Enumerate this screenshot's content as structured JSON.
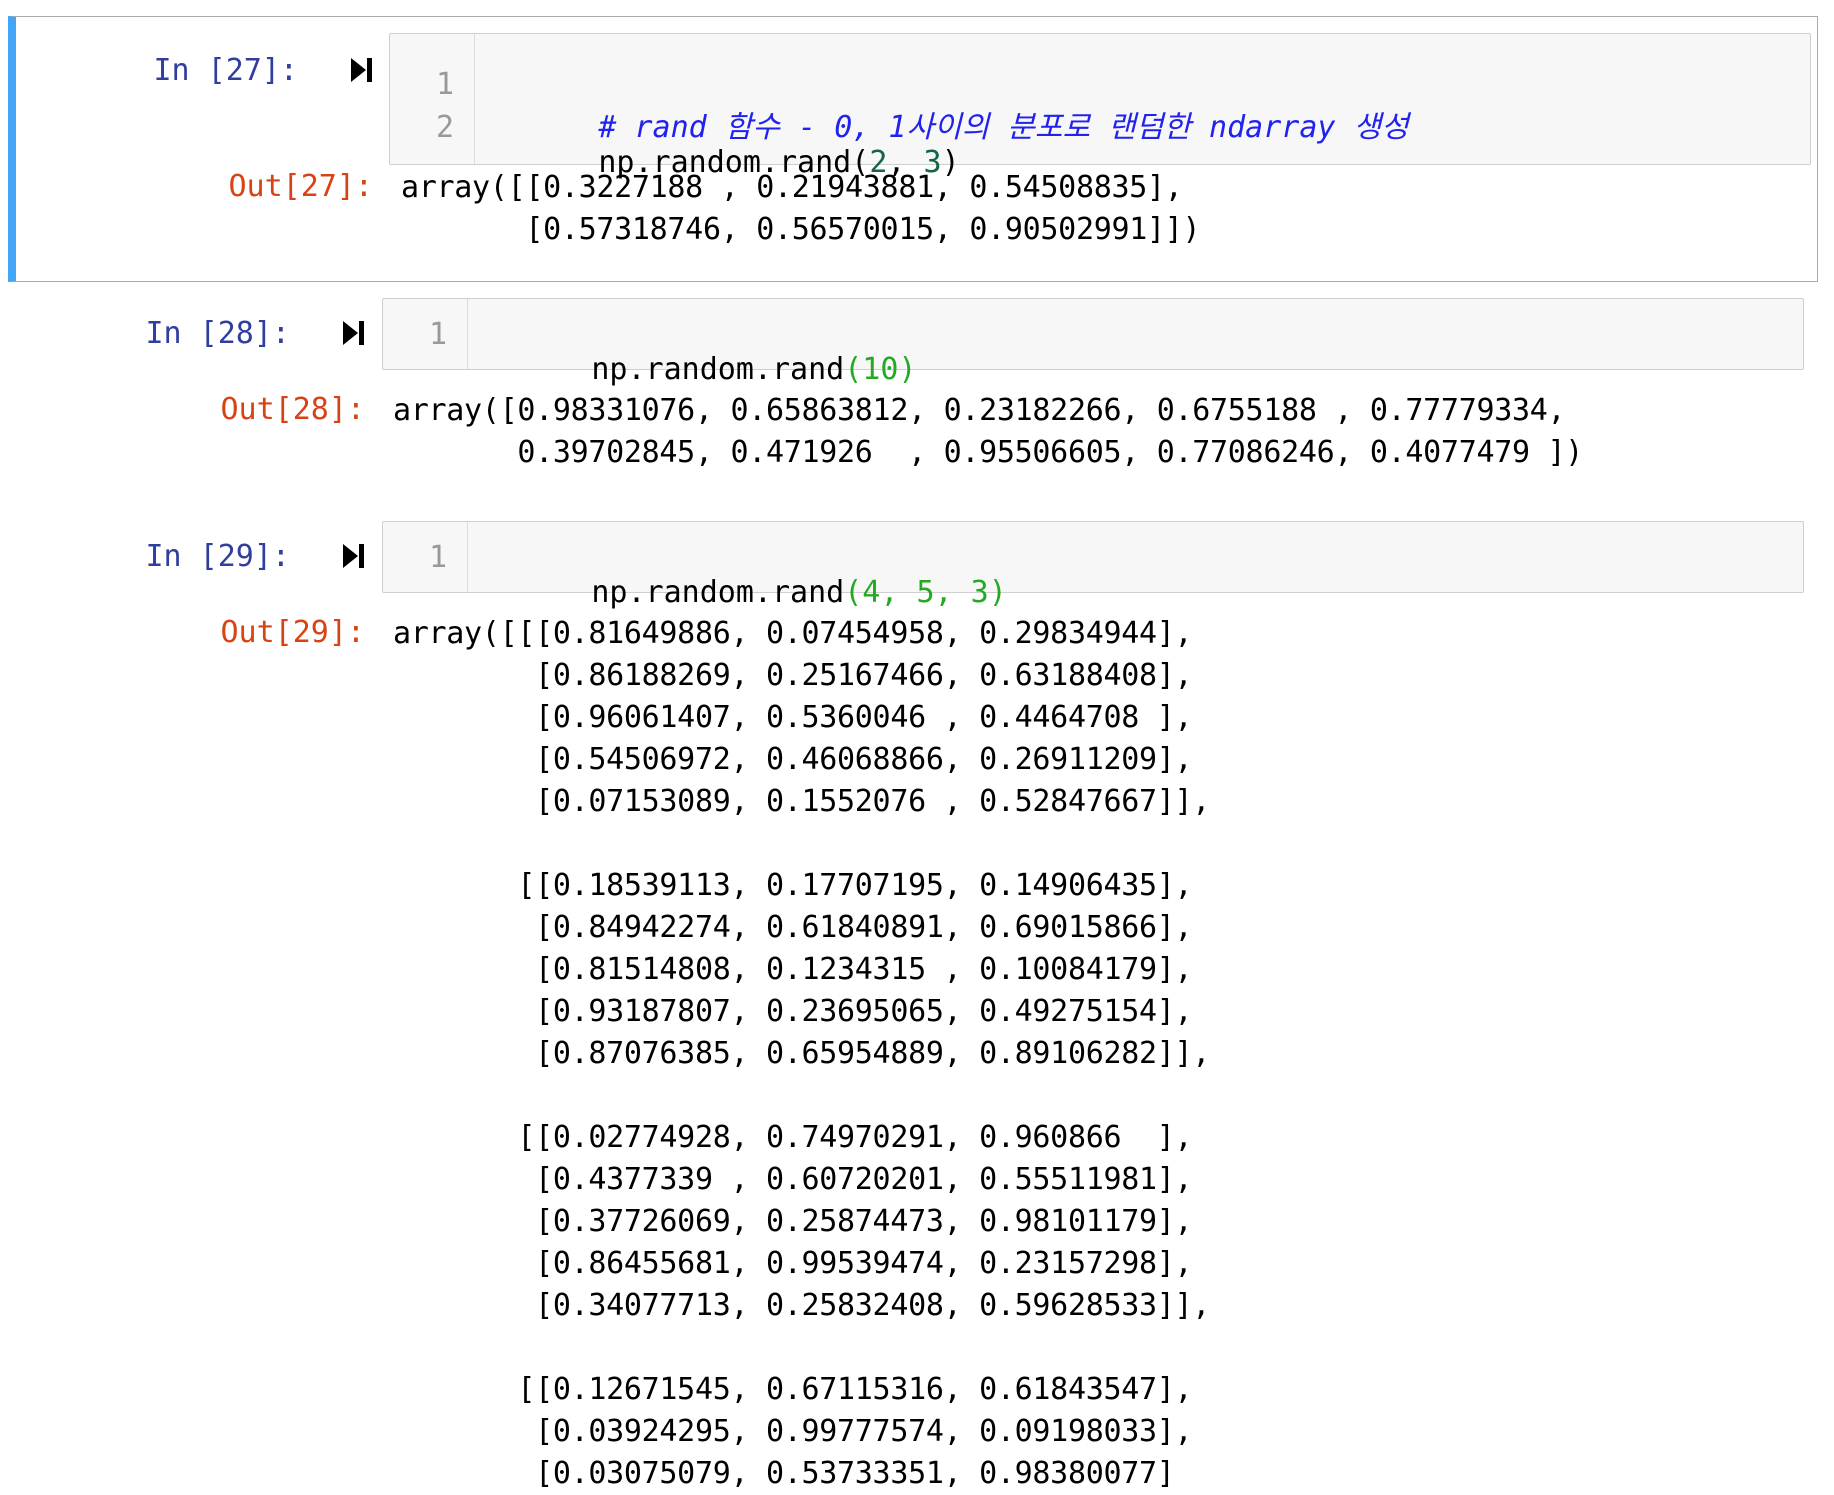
{
  "cells": [
    {
      "in_prompt": "In [27]:",
      "out_prompt": "Out[27]:",
      "code_lines": [
        {
          "n": "1",
          "comment": "# rand 함수 - 0, 1사이의 분포로 랜덤한 ndarray 생성"
        },
        {
          "n": "2",
          "pre": "np.random.rand(",
          "a1": "2",
          "sep": ", ",
          "a2": "3",
          "post": ")"
        }
      ],
      "output": "array([[0.3227188 , 0.21943881, 0.54508835],\n       [0.57318746, 0.56570015, 0.90502991]])"
    },
    {
      "in_prompt": "In [28]:",
      "out_prompt": "Out[28]:",
      "code_lines": [
        {
          "n": "1",
          "pre": "np.random.rand",
          "args": "(10)"
        }
      ],
      "output": "array([0.98331076, 0.65863812, 0.23182266, 0.6755188 , 0.77779334,\n       0.39702845, 0.471926  , 0.95506605, 0.77086246, 0.4077479 ])"
    },
    {
      "in_prompt": "In [29]:",
      "out_prompt": "Out[29]:",
      "code_lines": [
        {
          "n": "1",
          "pre": "np.random.rand",
          "args": "(4, 5, 3)"
        }
      ],
      "output": "array([[[0.81649886, 0.07454958, 0.29834944],\n        [0.86188269, 0.25167466, 0.63188408],\n        [0.96061407, 0.5360046 , 0.4464708 ],\n        [0.54506972, 0.46068866, 0.26911209],\n        [0.07153089, 0.1552076 , 0.52847667]],\n\n       [[0.18539113, 0.17707195, 0.14906435],\n        [0.84942274, 0.61840891, 0.69015866],\n        [0.81514808, 0.1234315 , 0.10084179],\n        [0.93187807, 0.23695065, 0.49275154],\n        [0.87076385, 0.65954889, 0.89106282]],\n\n       [[0.02774928, 0.74970291, 0.960866  ],\n        [0.4377339 , 0.60720201, 0.55511981],\n        [0.37726069, 0.25874473, 0.98101179],\n        [0.86455681, 0.99539474, 0.23157298],\n        [0.34077713, 0.25832408, 0.59628533]],\n\n       [[0.12671545, 0.67115316, 0.61843547],\n        [0.03924295, 0.99777574, 0.09198033],\n        [0.03075079, 0.53733351, 0.98380077]"
    }
  ],
  "icons": {
    "run": "run-cell-icon"
  },
  "colors": {
    "selected_bar": "#42a5f5",
    "in_prompt": "#303f9f",
    "out_prompt": "#d84315"
  }
}
